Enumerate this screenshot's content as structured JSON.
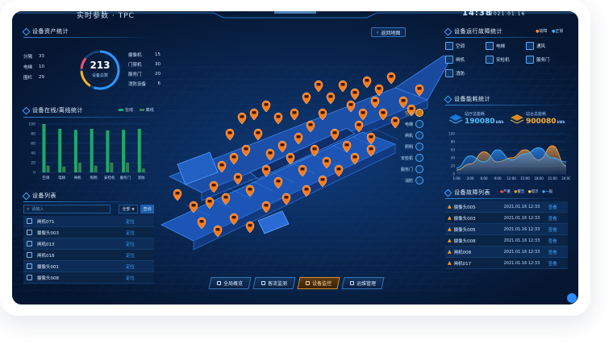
{
  "topbar": {
    "left_text": "实时参数 · TPC",
    "time": "14:38",
    "date": "2021.01.16"
  },
  "asset_stats": {
    "title": "设备资产统计",
    "total": "213",
    "total_label": "设备总数",
    "left_items": [
      {
        "label": "分隔",
        "value": "33"
      },
      {
        "label": "电梯",
        "value": "10"
      },
      {
        "label": "围栏",
        "value": "29"
      }
    ],
    "right_items": [
      {
        "label": "摄像机",
        "value": "15"
      },
      {
        "label": "门禁机",
        "value": "30"
      },
      {
        "label": "服务门",
        "value": "20"
      },
      {
        "label": "消防设备",
        "value": "6"
      }
    ]
  },
  "online_stats": {
    "title": "设备在线/离线统计",
    "legend": [
      "在线",
      "离线"
    ],
    "y_ticks": [
      "100",
      "80",
      "60",
      "40",
      "20",
      "0"
    ],
    "categories": [
      "空调",
      "电梯",
      "闸机",
      "照明",
      "安检机",
      "服务门",
      "消防"
    ],
    "chart_data": {
      "type": "bar",
      "categories": [
        "空调",
        "电梯",
        "闸机",
        "照明",
        "安检机",
        "服务门",
        "消防"
      ],
      "series": [
        {
          "name": "在线",
          "values": [
            100,
            90,
            88,
            90,
            87,
            88,
            90
          ]
        },
        {
          "name": "离线",
          "values": [
            14,
            12,
            20,
            14,
            20,
            20,
            8
          ]
        }
      ],
      "ylim": [
        0,
        100
      ]
    }
  },
  "device_list": {
    "title": "设备列表",
    "search_placeholder": "请输入",
    "filter_value": "全部",
    "query_label": "查询",
    "rows": [
      {
        "name": "闸机071",
        "action": "定位"
      },
      {
        "name": "摄像头003",
        "action": "定位"
      },
      {
        "name": "闸机013",
        "action": "定位"
      },
      {
        "name": "闸机018",
        "action": "定位"
      },
      {
        "name": "摄像头001",
        "action": "定位"
      },
      {
        "name": "摄像头008",
        "action": "定位"
      }
    ]
  },
  "map": {
    "back_label": "返回地图",
    "layers": [
      {
        "label": "空调",
        "active": true
      },
      {
        "label": "电梯",
        "active": false
      },
      {
        "label": "闸机",
        "active": false
      },
      {
        "label": "照明",
        "active": false
      },
      {
        "label": "安检机",
        "active": false
      },
      {
        "label": "服务门",
        "active": false
      },
      {
        "label": "消防",
        "active": false
      }
    ],
    "nav": [
      {
        "label": "全局概览",
        "active": false
      },
      {
        "label": "客流监测",
        "active": false
      },
      {
        "label": "设备监控",
        "active": true
      },
      {
        "label": "运维管理",
        "active": false
      }
    ]
  },
  "fault_stats": {
    "title": "设备运行故障统计",
    "legend": [
      "故障",
      "正常"
    ],
    "items": [
      "空调",
      "电梯",
      "通风",
      "闸机",
      "安检机",
      "服务门",
      "消防"
    ]
  },
  "energy": {
    "title": "设备能耗统计",
    "left_label": "站厅总能耗",
    "left_value": "190080",
    "left_unit": "kWh",
    "right_label": "站台总能耗",
    "right_value": "900080",
    "right_unit": "kWh",
    "x_ticks": [
      "1:00",
      "3:00",
      "6:00",
      "9:00",
      "12:00",
      "15:00",
      "18:00",
      "21:00",
      "24:00"
    ],
    "y_ticks": [
      "100",
      "80",
      "60",
      "40",
      "20",
      "0"
    ],
    "chart_data": {
      "type": "area",
      "x": [
        "1:00",
        "3:00",
        "6:00",
        "9:00",
        "12:00",
        "15:00",
        "18:00",
        "21:00",
        "24:00"
      ],
      "series": [
        {
          "name": "站厅",
          "values": [
            10,
            25,
            55,
            30,
            40,
            60,
            35,
            70,
            20
          ]
        },
        {
          "name": "站台",
          "values": [
            15,
            45,
            30,
            60,
            35,
            50,
            65,
            40,
            30
          ]
        }
      ],
      "ylim": [
        0,
        100
      ]
    }
  },
  "fault_list": {
    "title": "设备故障列表",
    "legend": [
      "严重",
      "警告",
      "提示",
      "一般"
    ],
    "rows": [
      {
        "name": "摄像头005",
        "date": "2021.01.16 12:33",
        "action": "查看"
      },
      {
        "name": "摄像头003",
        "date": "2021.01.16 12:33",
        "action": "查看"
      },
      {
        "name": "摄像头005",
        "date": "2021.01.16 12:33",
        "action": "查看"
      },
      {
        "name": "摄像头008",
        "date": "2021.01.16 12:33",
        "action": "查看"
      },
      {
        "name": "闸机008",
        "date": "2021.01.16 12:33",
        "action": "查看"
      },
      {
        "name": "闸机017",
        "date": "2021.01.16 12:33",
        "action": "查看"
      }
    ]
  },
  "colors": {
    "accent": "#2f95ff",
    "online": "#1fa86a",
    "offline": "#3a7a5a",
    "pin": "#ff7a1a"
  }
}
